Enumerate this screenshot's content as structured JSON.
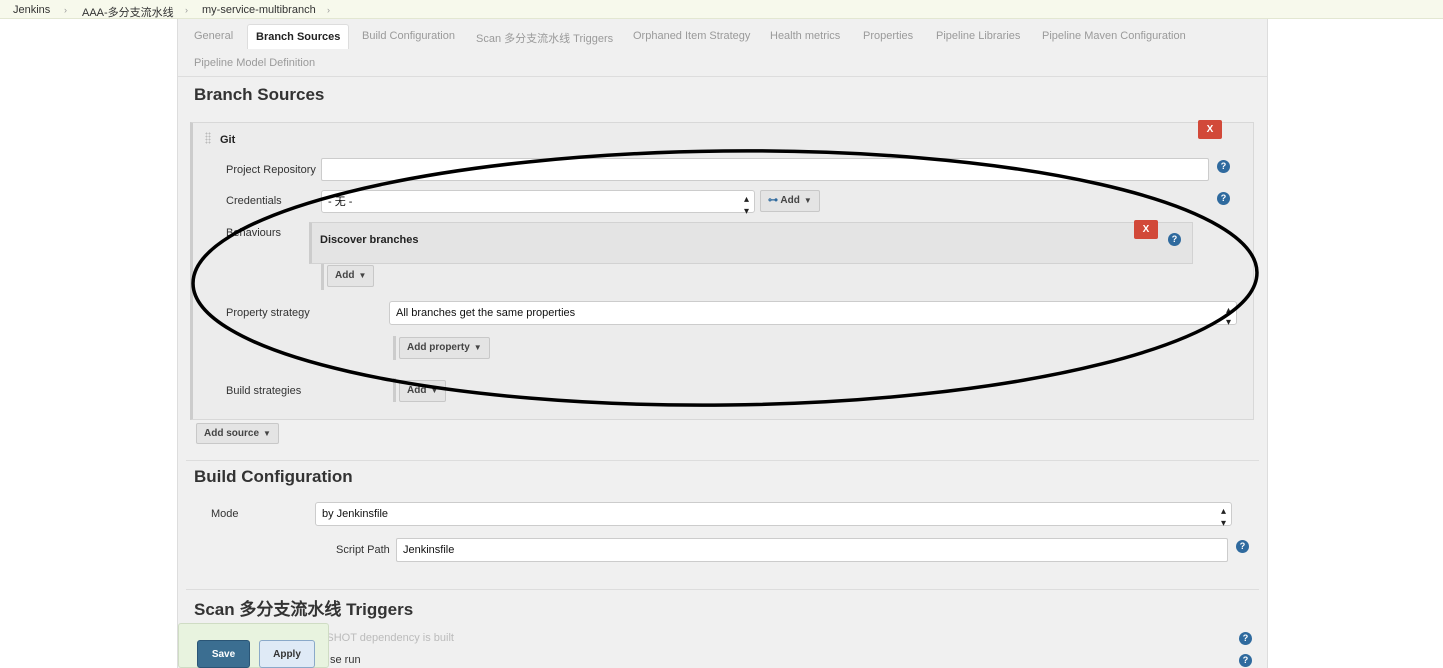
{
  "breadcrumb": {
    "items": [
      "Jenkins",
      "AAA-多分支流水线",
      "my-service-multibranch"
    ]
  },
  "tabs": {
    "row1": [
      "General",
      "Branch Sources",
      "Build Configuration",
      "Scan 多分支流水线 Triggers",
      "Orphaned Item Strategy",
      "Health metrics",
      "Properties",
      "Pipeline Libraries",
      "Pipeline Maven Configuration"
    ],
    "row2": [
      "Pipeline Model Definition"
    ],
    "active": "Branch Sources"
  },
  "branch_sources": {
    "title": "Branch Sources",
    "git_title": "Git",
    "project_repository_label": "Project Repository",
    "project_repository_value": "",
    "credentials_label": "Credentials",
    "credentials_value": "- 无 -",
    "credentials_add": "Add",
    "behaviours_label": "Behaviours",
    "discover_branches": "Discover branches",
    "behaviours_add": "Add",
    "property_strategy_label": "Property strategy",
    "property_strategy_value": "All branches get the same properties",
    "add_property": "Add property",
    "build_strategies_label": "Build strategies",
    "build_strategies_add": "Add",
    "add_source": "Add source",
    "delete": "X"
  },
  "build_configuration": {
    "title": "Build Configuration",
    "mode_label": "Mode",
    "mode_value": "by Jenkinsfile",
    "script_path_label": "Script Path",
    "script_path_value": "Jenkinsfile"
  },
  "scan_triggers": {
    "title": "Scan 多分支流水线 Triggers",
    "item1": "Build whenever a SNAPSHOT dependency is built",
    "item2_visible": "se run"
  },
  "footer": {
    "save": "Save",
    "apply": "Apply"
  },
  "help_glyph": "?",
  "colors": {
    "delete_red": "#d24939",
    "save_blue": "#3b6e91",
    "help_blue": "#2f6a9e"
  }
}
